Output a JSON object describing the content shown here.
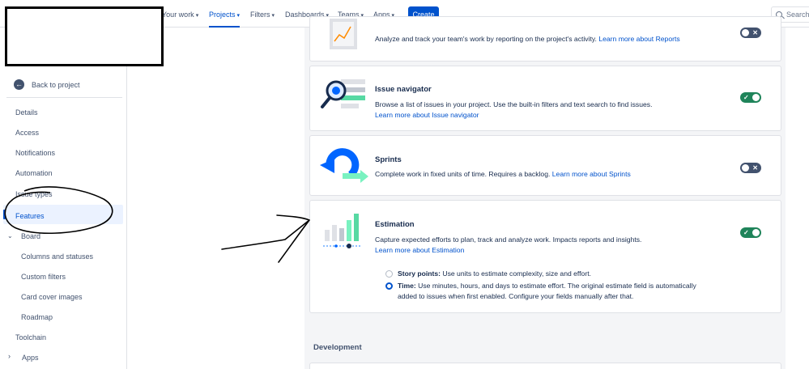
{
  "topnav": {
    "items": [
      {
        "label": "Your work",
        "active": false
      },
      {
        "label": "Projects",
        "active": true
      },
      {
        "label": "Filters",
        "active": false
      },
      {
        "label": "Dashboards",
        "active": false
      },
      {
        "label": "Teams",
        "active": false
      },
      {
        "label": "Apps",
        "active": false
      }
    ],
    "create_label": "Create",
    "search_placeholder": "Search"
  },
  "sidebar": {
    "back_label": "Back to project",
    "items": [
      "Details",
      "Access",
      "Notifications",
      "Automation",
      "Issue types",
      "Features"
    ],
    "board_label": "Board",
    "board_children": [
      "Columns and statuses",
      "Custom filters",
      "Card cover images",
      "Roadmap"
    ],
    "toolchain_label": "Toolchain",
    "apps_label": "Apps"
  },
  "features": {
    "reports": {
      "desc": "Analyze and track your team's work by reporting on the project's activity.",
      "link": "Learn more about Reports",
      "enabled": false
    },
    "issue_navigator": {
      "title": "Issue navigator",
      "desc": "Browse a list of issues in your project. Use the built-in filters and text search to find issues.",
      "link": "Learn more about Issue navigator",
      "enabled": true
    },
    "sprints": {
      "title": "Sprints",
      "desc": "Complete work in fixed units of time. Requires a backlog.",
      "link": "Learn more about Sprints",
      "enabled": false
    },
    "estimation": {
      "title": "Estimation",
      "desc": "Capture expected efforts to plan, track and analyze work. Impacts reports and insights.",
      "link": "Learn more about Estimation",
      "enabled": true,
      "options": [
        {
          "label": "Story points:",
          "desc": "Use units to estimate complexity, size and effort.",
          "checked": false
        },
        {
          "label": "Time:",
          "desc": "Use minutes, hours, and days to estimate effort. The original estimate field is automatically",
          "desc2": "added to issues when first enabled. Configure your fields manually after that.",
          "checked": true
        }
      ]
    }
  },
  "development_heading": "Development",
  "colors": {
    "accent": "#0052cc",
    "toggle_on": "#1f845a",
    "toggle_off": "#42526e"
  }
}
